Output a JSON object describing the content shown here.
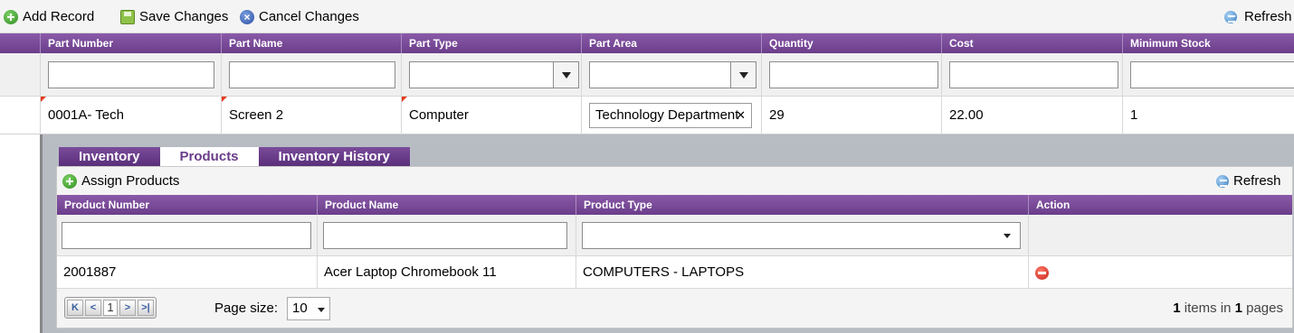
{
  "toolbar": {
    "add_record": "Add Record",
    "save_changes": "Save Changes",
    "cancel_changes": "Cancel Changes",
    "refresh": "Refresh"
  },
  "grid": {
    "columns": [
      "Part Number",
      "Part Name",
      "Part Type",
      "Part Area",
      "Quantity",
      "Cost",
      "Minimum Stock"
    ],
    "row": {
      "part_number": "0001A- Tech",
      "part_name": "Screen 2",
      "part_type": "Computer",
      "part_area": "Technology Department",
      "quantity": "29",
      "cost": "22.00",
      "minimum_stock": "1"
    }
  },
  "detail": {
    "tabs": [
      "Inventory",
      "Products",
      "Inventory History"
    ],
    "active_tab": "Products",
    "assign_products": "Assign Products",
    "refresh": "Refresh",
    "columns": [
      "Product Number",
      "Product Name",
      "Product Type",
      "Action"
    ],
    "row": {
      "product_number": "2001887",
      "product_name": "Acer Laptop Chromebook 11",
      "product_type": "COMPUTERS - LAPTOPS"
    },
    "pager": {
      "current_page": "1",
      "page_size_label": "Page size:",
      "page_size": "10",
      "items_count": "1",
      "items_in_text": "items in",
      "pages_count": "1",
      "pages_text": "pages"
    }
  },
  "colors": {
    "header_purple": "#6a3d8a",
    "detail_bg": "#b7bcc3",
    "dirty_marker": "#e53b1e"
  },
  "icons": [
    "plus-icon",
    "save-icon",
    "cancel-icon",
    "refresh-icon",
    "delete-icon",
    "chevron-down-icon"
  ]
}
